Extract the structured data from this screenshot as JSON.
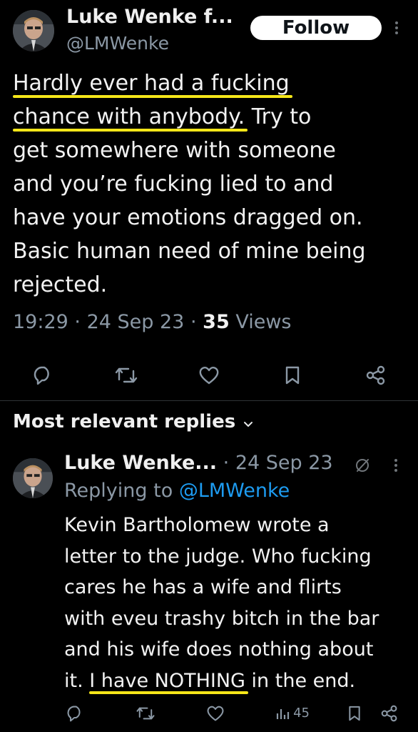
{
  "tweet": {
    "author_name": "Luke Wenke f...",
    "author_handle": "@LMWenke",
    "follow_label": "Follow",
    "text_lines": [
      "Hardly ever had a fucking",
      "chance with anybody.",
      " Try to",
      "get somewhere with someone",
      "and you’re fucking lied to and",
      "have your emotions dragged on.",
      "Basic human need of mine being",
      "rejected."
    ],
    "time": "19:29",
    "date": "24 Sep 23",
    "views_count": "35",
    "views_label": "Views",
    "separator": "·"
  },
  "replies_section": {
    "heading": "Most relevant replies",
    "chevron": "⌄"
  },
  "reply": {
    "author_name": "Luke Wenke...",
    "date": "24 Sep 23",
    "separator": "·",
    "replying_prefix": "Replying to",
    "replying_handle": "@LMWenke",
    "text_lines": [
      "Kevin Bartholomew wrote a",
      "letter to the judge.  Who fucking",
      "cares he has a wife and flirts",
      "with eveu trashy bitch in the bar",
      "and his wife does nothing about"
    ],
    "last_line_prefix": "it. ",
    "last_line_highlight": "I have NOTHING",
    "last_line_suffix": " in the end.",
    "views_count": "45"
  },
  "colors": {
    "background": "#000000",
    "text": "#e7e9ea",
    "secondary": "#8b98a5",
    "link": "#1d9bf0",
    "highlight_underline": "#f5e619"
  },
  "icons": [
    "reply-icon",
    "retweet-icon",
    "like-icon",
    "bookmark-icon",
    "share-icon",
    "more-icon",
    "grok-icon",
    "views-icon"
  ]
}
